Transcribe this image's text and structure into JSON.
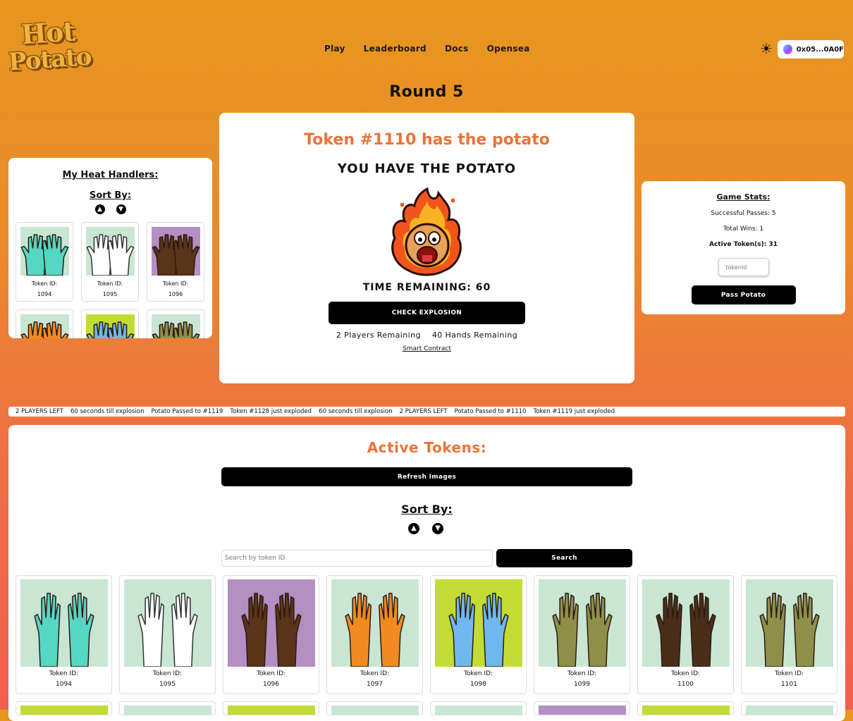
{
  "header": {
    "logo_top": "Hot",
    "logo_bottom": "Potato",
    "nav": [
      "Play",
      "Leaderboard",
      "Docs",
      "Opensea"
    ],
    "theme_icon": "sun-icon",
    "wallet_address": "0x05...0A0F"
  },
  "round_label": "Round 5",
  "main": {
    "holder_text": "Token #1110 has the potato",
    "status_text": "YOU HAVE THE POTATO",
    "time_remaining": "TIME REMAINING: 60",
    "check_button": "CHECK EXPLOSION",
    "players_remaining": "2 Players Remaining",
    "hands_remaining": "40 Hands Remaining",
    "contract_link": "Smart Contract"
  },
  "heat_handlers": {
    "title": "My Heat Handlers:",
    "sort_label": "Sort By:",
    "tokens": [
      {
        "label": "Token ID:",
        "id": "1094",
        "bg": "#c9e6d3",
        "hand": "#56d6c4"
      },
      {
        "label": "Token ID:",
        "id": "1095",
        "bg": "#c9e6d3",
        "hand": "#ffffff"
      },
      {
        "label": "Token ID:",
        "id": "1096",
        "bg": "#b48fc4",
        "hand": "#5a3418"
      },
      {
        "label": "",
        "id": "",
        "bg": "#c9e6d3",
        "hand": "#f28a22"
      },
      {
        "label": "",
        "id": "",
        "bg": "#c3dc35",
        "hand": "#6fb8ee"
      },
      {
        "label": "",
        "id": "",
        "bg": "#c9e6d3",
        "hand": "#8f8f4a"
      }
    ]
  },
  "game_stats": {
    "title": "Game Stats:",
    "passes": "Successful Passes: 5",
    "wins": "Total Wins: 1",
    "active": "Active Token(s): 31",
    "input_placeholder": "tokenId",
    "pass_button": "Pass Potato"
  },
  "ticker": [
    "2 PLAYERS LEFT",
    "60 seconds till explosion",
    "Potato Passed to #1119",
    "Token #1128 just exploded",
    "60 seconds till explosion",
    "2 PLAYERS LEFT",
    "Potato Passed to #1110",
    "Token #1119 just exploded"
  ],
  "active_tokens": {
    "title": "Active Tokens:",
    "refresh_button": "Refresh Images",
    "sort_label": "Sort By:",
    "search_placeholder": "Search by token ID",
    "search_button": "Search",
    "tokens": [
      {
        "label": "Token ID:",
        "id": "1094",
        "bg": "#c9e6d3",
        "hand": "#56d6c4"
      },
      {
        "label": "Token ID:",
        "id": "1095",
        "bg": "#c9e6d3",
        "hand": "#ffffff"
      },
      {
        "label": "Token ID:",
        "id": "1096",
        "bg": "#b48fc4",
        "hand": "#5a3418"
      },
      {
        "label": "Token ID:",
        "id": "1097",
        "bg": "#c9e6d3",
        "hand": "#f28a22"
      },
      {
        "label": "Token ID:",
        "id": "1098",
        "bg": "#c3dc35",
        "hand": "#6fb8ee"
      },
      {
        "label": "Token ID:",
        "id": "1099",
        "bg": "#c9e6d3",
        "hand": "#8f8f4a"
      },
      {
        "label": "Token ID:",
        "id": "1100",
        "bg": "#c9e6d3",
        "hand": "#4a2e1a"
      },
      {
        "label": "Token ID:",
        "id": "1101",
        "bg": "#c9e6d3",
        "hand": "#8f8f4a"
      }
    ],
    "next_row_bgs": [
      "#c3dc35",
      "#c9e6d3",
      "#c3dc35",
      "#c9e6d3",
      "#c9e6d3",
      "#b48fc4",
      "#c3dc35",
      "#c9e6d3"
    ]
  },
  "colors": {
    "accent_orange": "#e8743a",
    "button_black": "#000000"
  }
}
